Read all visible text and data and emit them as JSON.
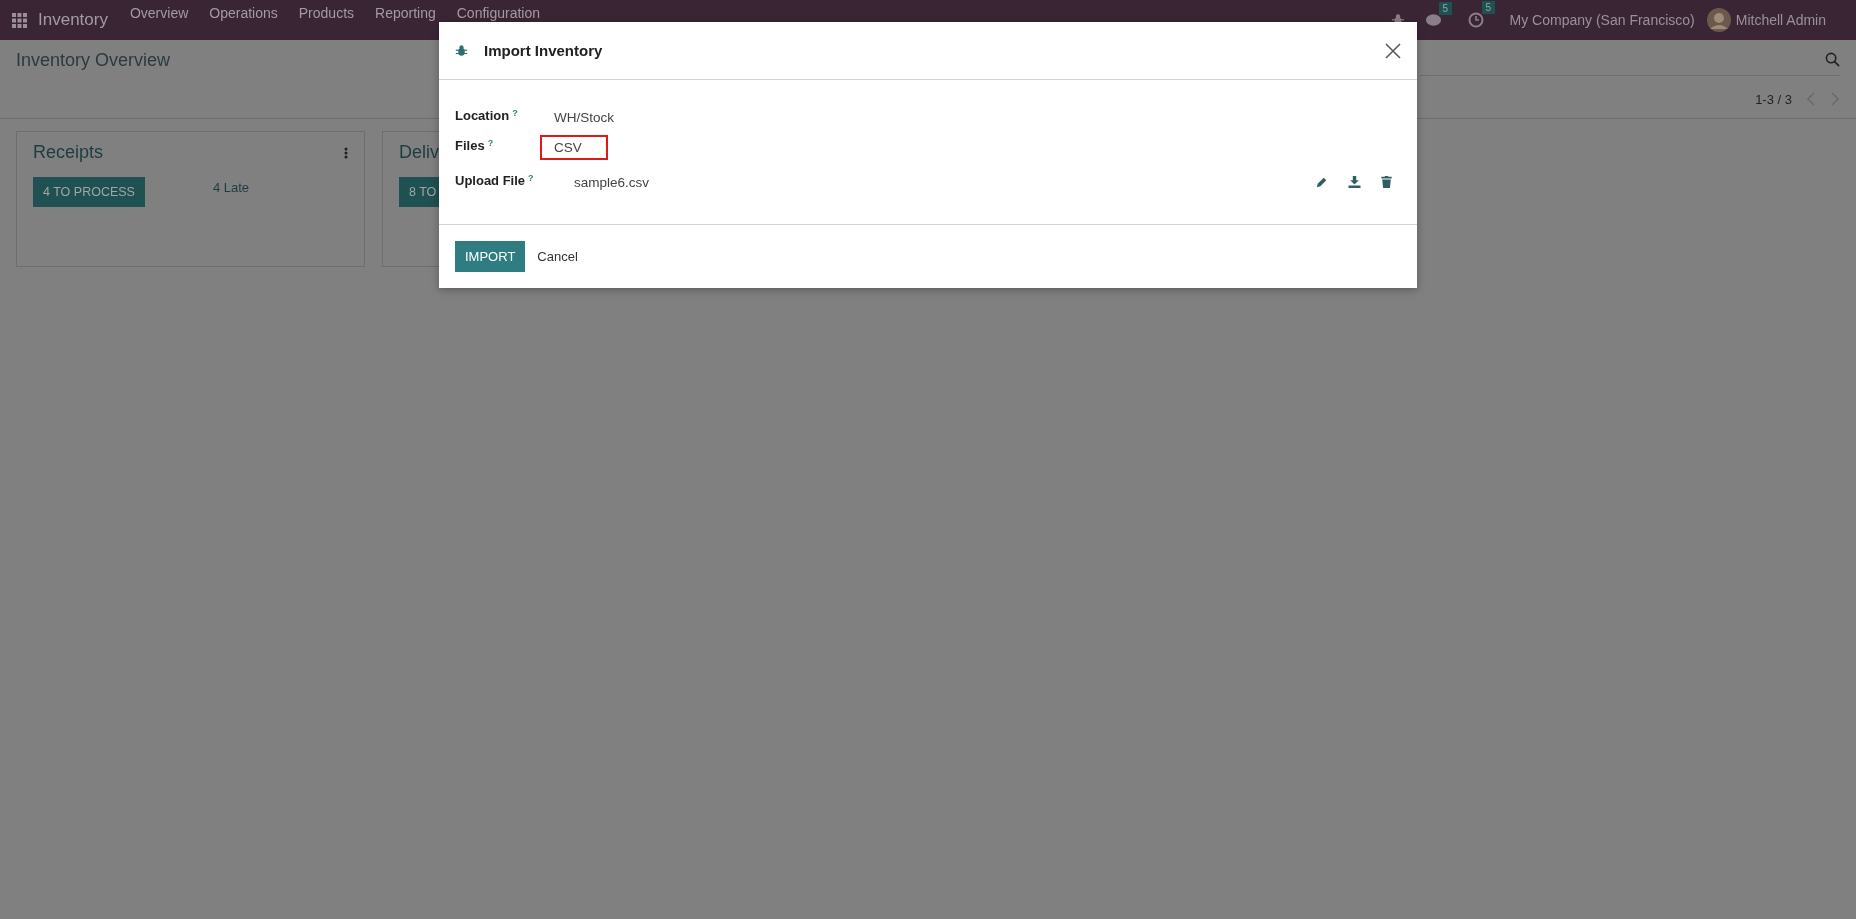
{
  "navbar": {
    "app_name": "Inventory",
    "menu": [
      "Overview",
      "Operations",
      "Products",
      "Reporting",
      "Configuration"
    ],
    "chat_badge": "5",
    "activity_badge": "5",
    "company": "My Company (San Francisco)",
    "user": "Mitchell Admin"
  },
  "page": {
    "title": "Inventory Overview",
    "pager": "1-3 / 3"
  },
  "cards": [
    {
      "title": "Receipts",
      "button": "4 TO PROCESS",
      "late": "4 Late"
    },
    {
      "title": "Deliv",
      "button": "8 TO"
    }
  ],
  "dialog": {
    "title": "Import Inventory",
    "fields": [
      {
        "kind": "text",
        "label": "Location",
        "help": "?",
        "value": "WH/Stock",
        "highlighted": false
      },
      {
        "kind": "text",
        "label": "Files",
        "help": "?",
        "value": "CSV",
        "highlighted": true
      },
      {
        "kind": "file",
        "label": "Upload File",
        "help": "?",
        "value": "sample6.csv",
        "highlighted": false
      }
    ],
    "buttons": [
      "IMPORT",
      "Cancel"
    ]
  }
}
